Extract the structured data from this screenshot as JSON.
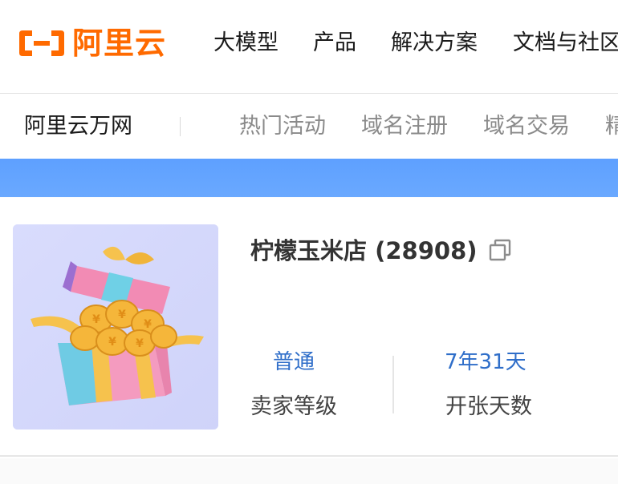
{
  "header": {
    "brand": "阿里云",
    "nav": [
      "大模型",
      "产品",
      "解决方案",
      "文档与社区"
    ]
  },
  "subnav": {
    "brand": "阿里云万网",
    "items": [
      "热门活动",
      "域名注册",
      "域名交易",
      "精"
    ]
  },
  "shop": {
    "name": "柠檬玉米店 (28908)",
    "seller_level_value": "普通",
    "seller_level_label": "卖家等级",
    "open_days_value": "7年31天",
    "open_days_label": "开张天数"
  },
  "colors": {
    "brand_orange": "#ff6a00",
    "banner_blue": "#66a6ff",
    "stat_blue": "#2f6ec9"
  },
  "icons": {
    "copy": "copy-icon",
    "shop_image": "gift-box-with-coins"
  }
}
